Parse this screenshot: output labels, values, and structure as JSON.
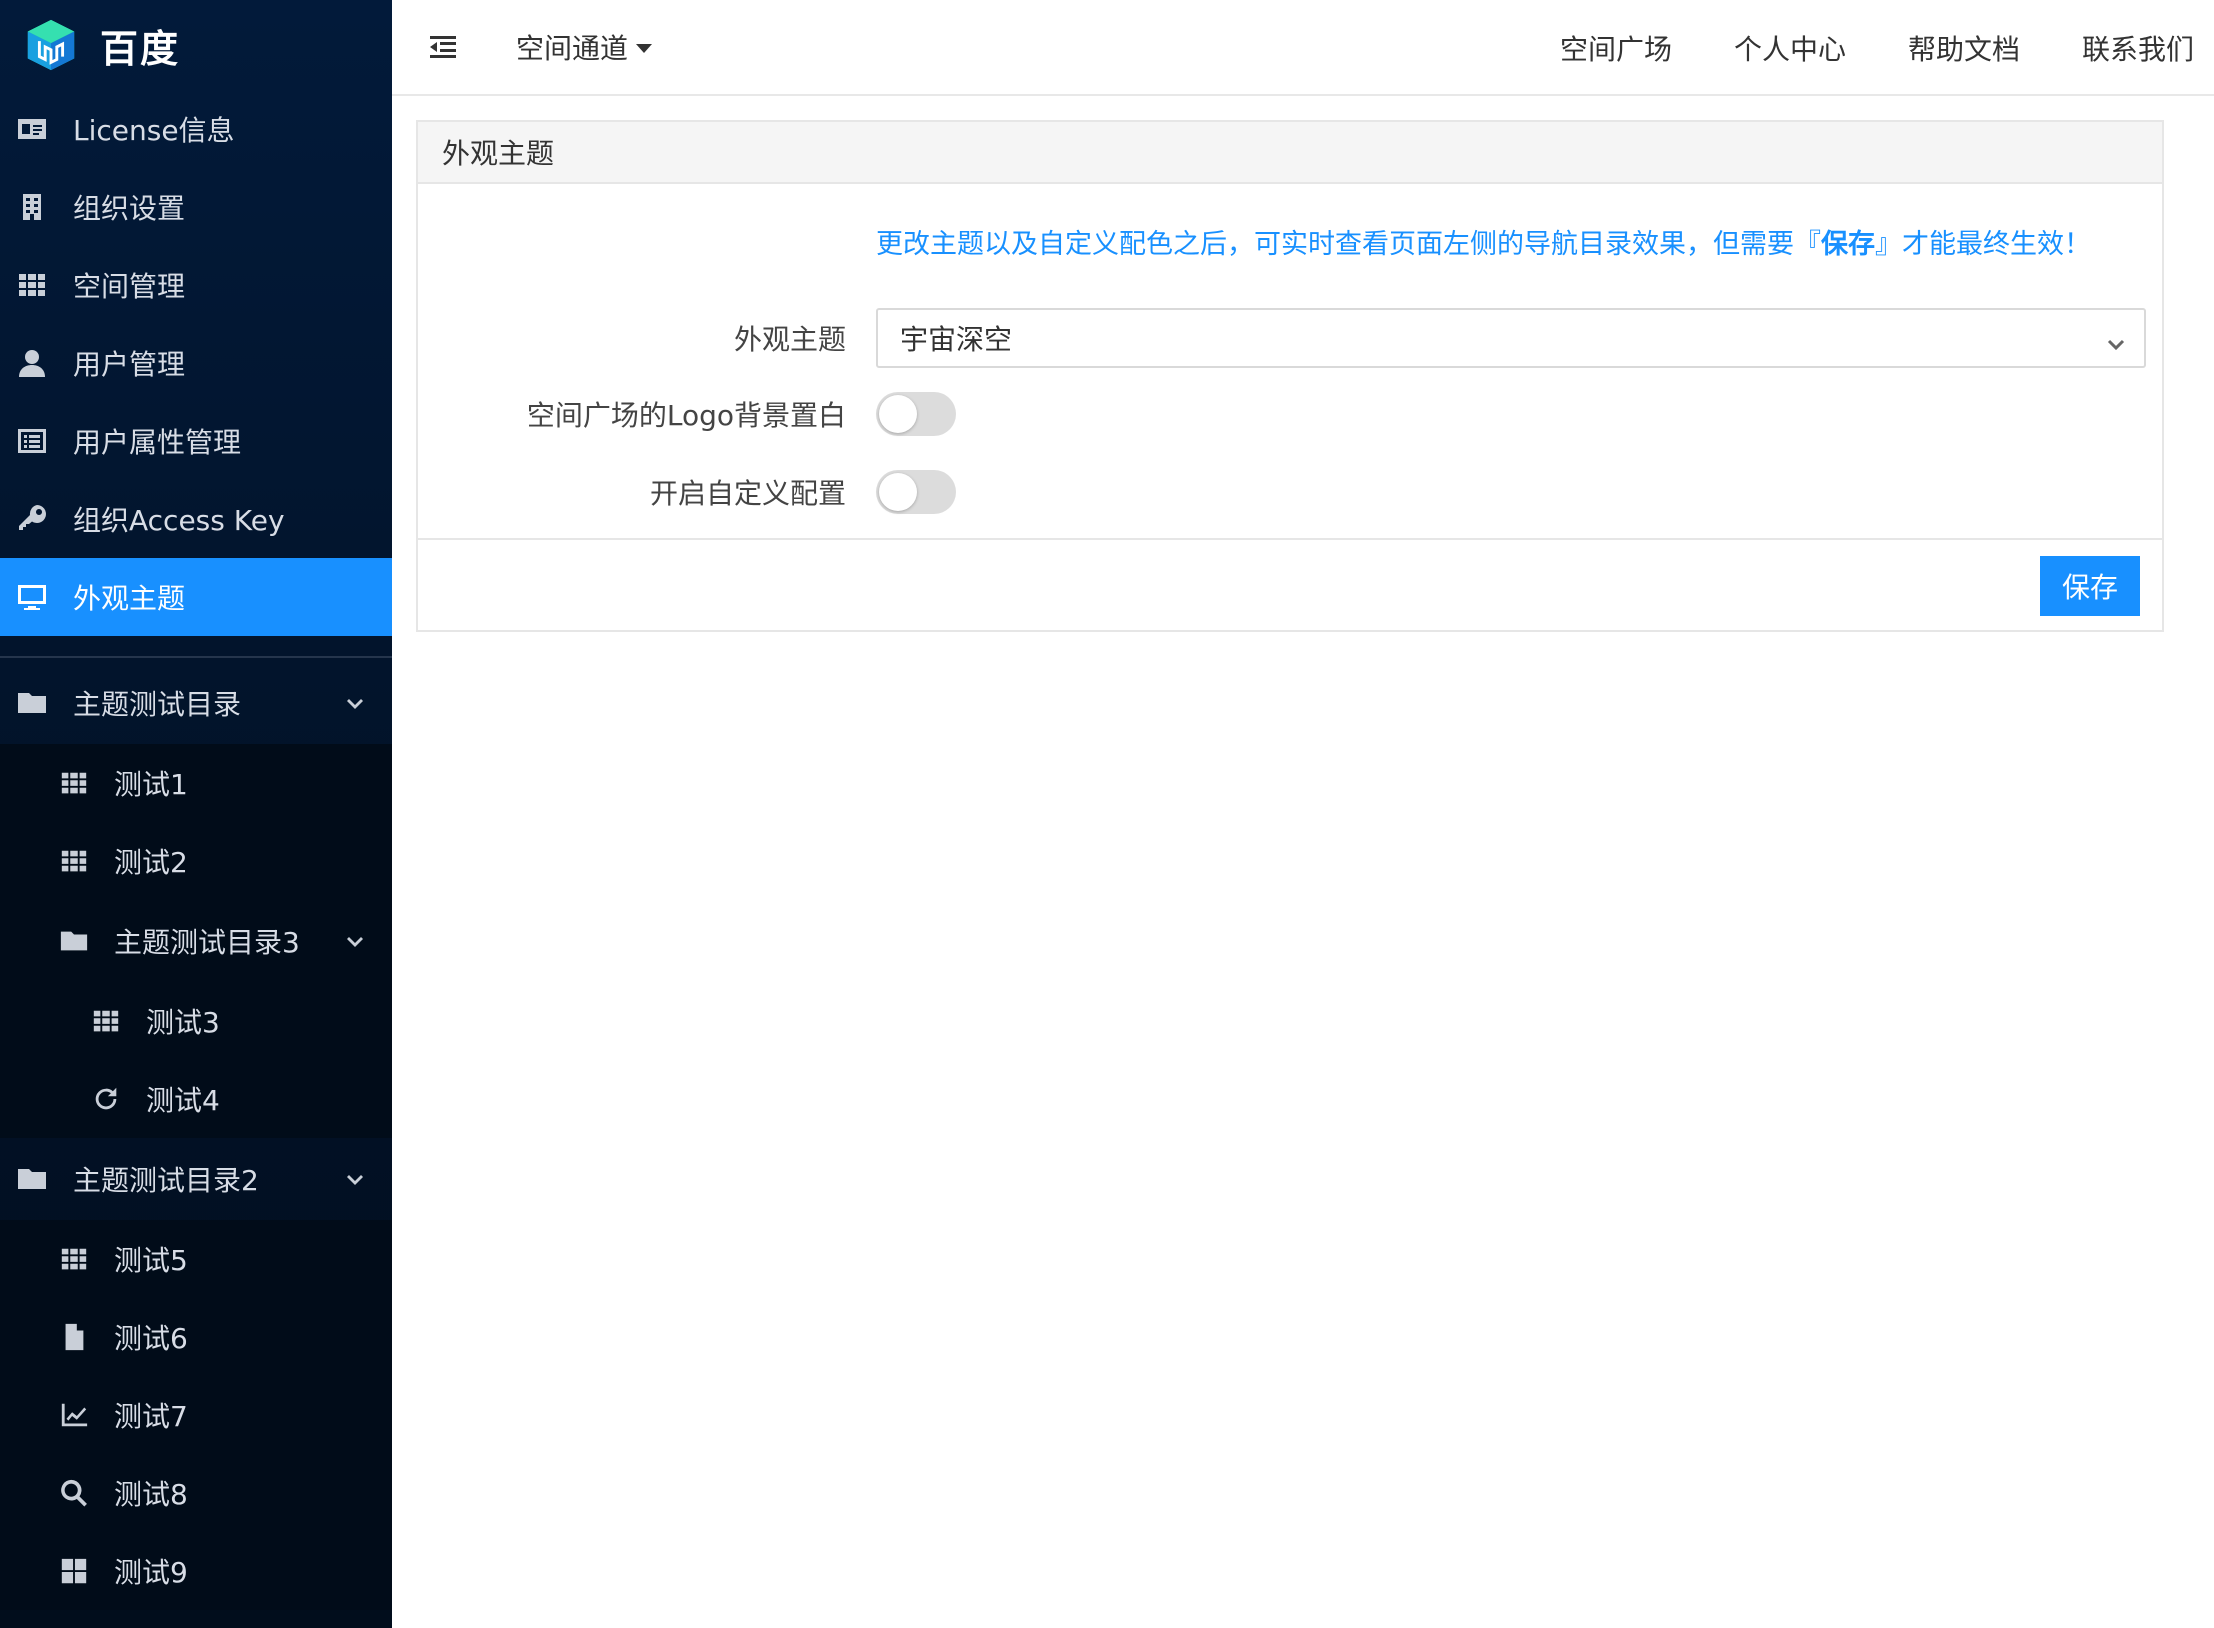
{
  "brand": {
    "name": "百度"
  },
  "sidebar": {
    "items": [
      {
        "label": "License信息",
        "icon": "id-card-icon"
      },
      {
        "label": "组织设置",
        "icon": "building-icon"
      },
      {
        "label": "空间管理",
        "icon": "grid-icon"
      },
      {
        "label": "用户管理",
        "icon": "user-icon"
      },
      {
        "label": "用户属性管理",
        "icon": "list-icon"
      },
      {
        "label": "组织Access Key",
        "icon": "key-icon"
      },
      {
        "label": "外观主题",
        "icon": "monitor-icon",
        "active": true
      }
    ],
    "groups": [
      {
        "label": "主题测试目录",
        "children": [
          {
            "label": "测试1",
            "icon": "grid-icon"
          },
          {
            "label": "测试2",
            "icon": "grid-icon"
          }
        ],
        "subgroup": {
          "label": "主题测试目录3",
          "children": [
            {
              "label": "测试3",
              "icon": "grid-icon"
            },
            {
              "label": "测试4",
              "icon": "refresh-icon"
            }
          ]
        }
      },
      {
        "label": "主题测试目录2",
        "children": [
          {
            "label": "测试5",
            "icon": "grid-icon"
          },
          {
            "label": "测试6",
            "icon": "file-icon"
          },
          {
            "label": "测试7",
            "icon": "chart-icon"
          },
          {
            "label": "测试8",
            "icon": "search-icon"
          },
          {
            "label": "测试9",
            "icon": "windows-icon"
          }
        ]
      }
    ]
  },
  "header": {
    "space_channel": "空间通道",
    "links": [
      "空间广场",
      "个人中心",
      "帮助文档",
      "联系我们"
    ]
  },
  "panel": {
    "title": "外观主题",
    "notice_prefix": "更改主题以及自定义配色之后，可实时查看页面左侧的导航目录效果，但需要『",
    "notice_bold": "保存",
    "notice_suffix": "』才能最终生效！",
    "theme_label": "外观主题",
    "theme_value": "宇宙深空",
    "logo_bg_label": "空间广场的Logo背景置白",
    "logo_bg_on": false,
    "custom_label": "开启自定义配置",
    "custom_on": false,
    "save_label": "保存"
  },
  "colors": {
    "accent": "#1890ff",
    "sidebar_bg": "#021a3a",
    "switch_off": "#dcdcdc"
  }
}
